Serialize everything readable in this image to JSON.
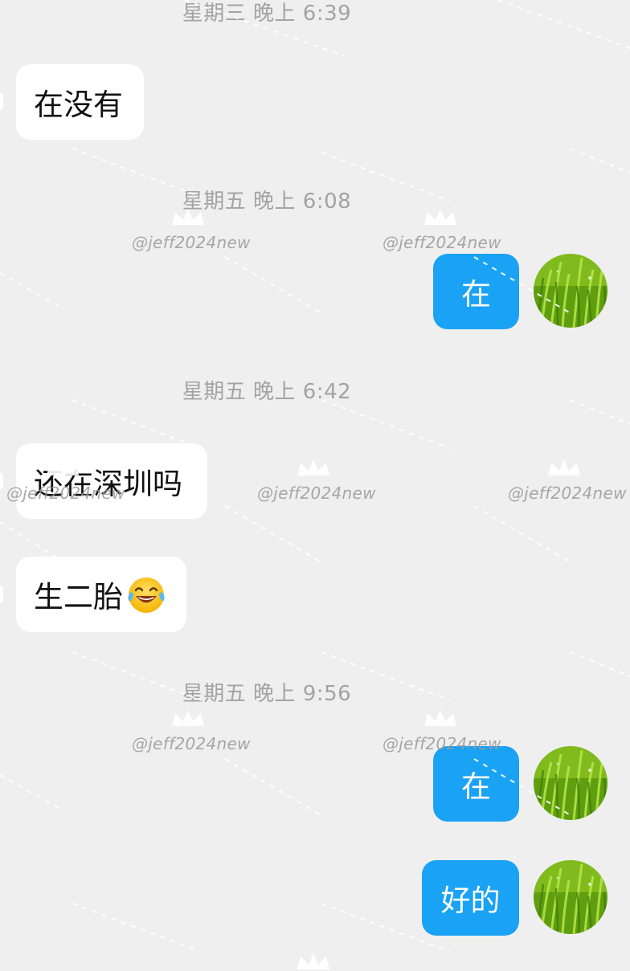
{
  "timestamps": [
    "星期三 晚上 6:39",
    "星期五 晚上 6:08",
    "星期五 晚上 6:42",
    "星期五 晚上 9:56"
  ],
  "messages": [
    {
      "side": "in",
      "text": "在没有"
    },
    {
      "side": "out",
      "text": "在"
    },
    {
      "side": "in",
      "text": "还在深圳吗"
    },
    {
      "side": "in",
      "text": "生二胎",
      "emoji": "tears-of-joy-emoji"
    },
    {
      "side": "out",
      "text": "在"
    },
    {
      "side": "out",
      "text": "好的"
    }
  ],
  "watermark": {
    "text": "@jeff2024new",
    "icon": "crown-icon"
  },
  "avatar": {
    "icon": "grass-avatar"
  },
  "colors": {
    "background": "#efefef",
    "incoming_bubble": "#ffffff",
    "outgoing_bubble": "#1aa2f5",
    "timestamp_text": "#a3a3a3",
    "avatar_green": "#7cc21f"
  }
}
